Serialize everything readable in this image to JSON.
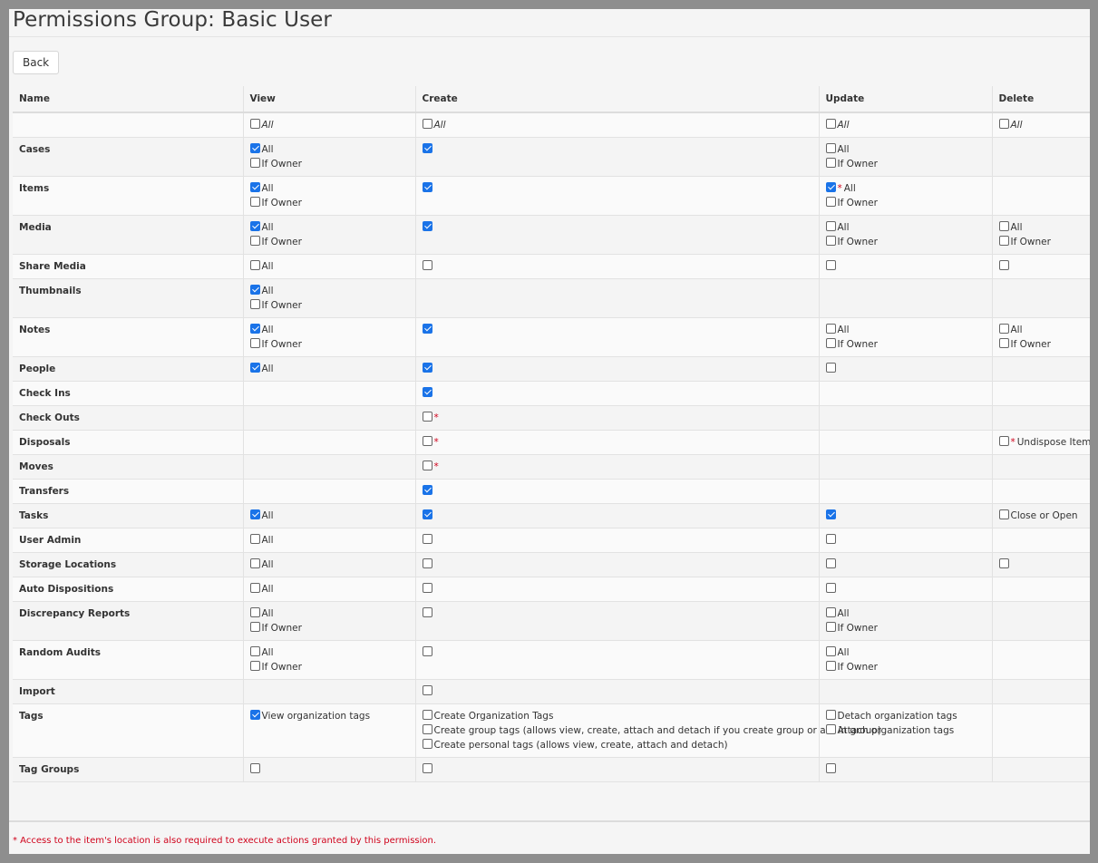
{
  "page": {
    "title": "Permissions Group: Basic User",
    "back_label": "Back",
    "footnote": "* Access to the item's location is also required to execute actions granted by this permission."
  },
  "columns": [
    "Name",
    "View",
    "Create",
    "Update",
    "Delete"
  ],
  "rows": [
    {
      "name": "",
      "view": [
        {
          "label": "All",
          "checked": false,
          "italic": true
        }
      ],
      "create": [
        {
          "label": "All",
          "checked": false,
          "italic": true
        }
      ],
      "update": [
        {
          "label": "All",
          "checked": false,
          "italic": true
        }
      ],
      "delete": [
        {
          "label": "All",
          "checked": false,
          "italic": true
        }
      ]
    },
    {
      "name": "Cases",
      "view": [
        {
          "label": "All",
          "checked": true
        },
        {
          "label": "If Owner",
          "checked": false
        }
      ],
      "create": [
        {
          "label": "",
          "checked": true
        }
      ],
      "update": [
        {
          "label": "All",
          "checked": false
        },
        {
          "label": "If Owner",
          "checked": false
        }
      ],
      "delete": []
    },
    {
      "name": "Items",
      "view": [
        {
          "label": "All",
          "checked": true
        },
        {
          "label": "If Owner",
          "checked": false
        }
      ],
      "create": [
        {
          "label": "",
          "checked": true
        }
      ],
      "update": [
        {
          "label": "All",
          "checked": true,
          "star": true
        },
        {
          "label": "If Owner",
          "checked": false
        }
      ],
      "delete": []
    },
    {
      "name": "Media",
      "view": [
        {
          "label": "All",
          "checked": true
        },
        {
          "label": "If Owner",
          "checked": false
        }
      ],
      "create": [
        {
          "label": "",
          "checked": true
        }
      ],
      "update": [
        {
          "label": "All",
          "checked": false
        },
        {
          "label": "If Owner",
          "checked": false
        }
      ],
      "delete": [
        {
          "label": "All",
          "checked": false
        },
        {
          "label": "If Owner",
          "checked": false
        }
      ]
    },
    {
      "name": "Share Media",
      "view": [
        {
          "label": "All",
          "checked": false
        }
      ],
      "create": [
        {
          "label": "",
          "checked": false
        }
      ],
      "update": [
        {
          "label": "",
          "checked": false
        }
      ],
      "delete": [
        {
          "label": "",
          "checked": false
        }
      ]
    },
    {
      "name": "Thumbnails",
      "view": [
        {
          "label": "All",
          "checked": true
        },
        {
          "label": "If Owner",
          "checked": false
        }
      ],
      "create": [],
      "update": [],
      "delete": []
    },
    {
      "name": "Notes",
      "view": [
        {
          "label": "All",
          "checked": true
        },
        {
          "label": "If Owner",
          "checked": false
        }
      ],
      "create": [
        {
          "label": "",
          "checked": true
        }
      ],
      "update": [
        {
          "label": "All",
          "checked": false
        },
        {
          "label": "If Owner",
          "checked": false
        }
      ],
      "delete": [
        {
          "label": "All",
          "checked": false
        },
        {
          "label": "If Owner",
          "checked": false
        }
      ]
    },
    {
      "name": "People",
      "view": [
        {
          "label": "All",
          "checked": true
        }
      ],
      "create": [
        {
          "label": "",
          "checked": true
        }
      ],
      "update": [
        {
          "label": "",
          "checked": false
        }
      ],
      "delete": []
    },
    {
      "name": "Check Ins",
      "view": [],
      "create": [
        {
          "label": "",
          "checked": true
        }
      ],
      "update": [],
      "delete": []
    },
    {
      "name": "Check Outs",
      "view": [],
      "create": [
        {
          "label": "",
          "checked": false,
          "star": true
        }
      ],
      "update": [],
      "delete": []
    },
    {
      "name": "Disposals",
      "view": [],
      "create": [
        {
          "label": "",
          "checked": false,
          "star": true
        }
      ],
      "update": [],
      "delete": [
        {
          "label": "Undispose Item",
          "checked": false,
          "star": true
        }
      ]
    },
    {
      "name": "Moves",
      "view": [],
      "create": [
        {
          "label": "",
          "checked": false,
          "star": true
        }
      ],
      "update": [],
      "delete": []
    },
    {
      "name": "Transfers",
      "view": [],
      "create": [
        {
          "label": "",
          "checked": true
        }
      ],
      "update": [],
      "delete": []
    },
    {
      "name": "Tasks",
      "view": [
        {
          "label": "All",
          "checked": true
        }
      ],
      "create": [
        {
          "label": "",
          "checked": true
        }
      ],
      "update": [
        {
          "label": "",
          "checked": true
        }
      ],
      "delete": [
        {
          "label": "Close or Open",
          "checked": false
        }
      ]
    },
    {
      "name": "User Admin",
      "view": [
        {
          "label": "All",
          "checked": false
        }
      ],
      "create": [
        {
          "label": "",
          "checked": false
        }
      ],
      "update": [
        {
          "label": "",
          "checked": false
        }
      ],
      "delete": []
    },
    {
      "name": "Storage Locations",
      "view": [
        {
          "label": "All",
          "checked": false
        }
      ],
      "create": [
        {
          "label": "",
          "checked": false
        }
      ],
      "update": [
        {
          "label": "",
          "checked": false
        }
      ],
      "delete": [
        {
          "label": "",
          "checked": false
        }
      ]
    },
    {
      "name": "Auto Dispositions",
      "view": [
        {
          "label": "All",
          "checked": false
        }
      ],
      "create": [
        {
          "label": "",
          "checked": false
        }
      ],
      "update": [
        {
          "label": "",
          "checked": false
        }
      ],
      "delete": []
    },
    {
      "name": "Discrepancy Reports",
      "view": [
        {
          "label": "All",
          "checked": false
        },
        {
          "label": "If Owner",
          "checked": false
        }
      ],
      "create": [
        {
          "label": "",
          "checked": false
        }
      ],
      "update": [
        {
          "label": "All",
          "checked": false
        },
        {
          "label": "If Owner",
          "checked": false
        }
      ],
      "delete": []
    },
    {
      "name": "Random Audits",
      "view": [
        {
          "label": "All",
          "checked": false
        },
        {
          "label": "If Owner",
          "checked": false
        }
      ],
      "create": [
        {
          "label": "",
          "checked": false
        }
      ],
      "update": [
        {
          "label": "All",
          "checked": false
        },
        {
          "label": "If Owner",
          "checked": false
        }
      ],
      "delete": []
    },
    {
      "name": "Import",
      "view": [],
      "create": [
        {
          "label": "",
          "checked": false
        }
      ],
      "update": [],
      "delete": []
    },
    {
      "name": "Tags",
      "view": [
        {
          "label": "View organization tags",
          "checked": true
        }
      ],
      "create": [
        {
          "label": "Create Organization Tags",
          "checked": false
        },
        {
          "label": "Create group tags (allows view, create, attach and detach if you create group or are in group)",
          "checked": false
        },
        {
          "label": "Create personal tags (allows view, create, attach and detach)",
          "checked": false
        }
      ],
      "update": [
        {
          "label": "Detach organization tags",
          "checked": false
        },
        {
          "label": "Attach organization tags",
          "checked": false
        }
      ],
      "delete": []
    },
    {
      "name": "Tag Groups",
      "view": [
        {
          "label": "",
          "checked": false
        }
      ],
      "create": [
        {
          "label": "",
          "checked": false
        }
      ],
      "update": [
        {
          "label": "",
          "checked": false
        }
      ],
      "delete": []
    }
  ]
}
